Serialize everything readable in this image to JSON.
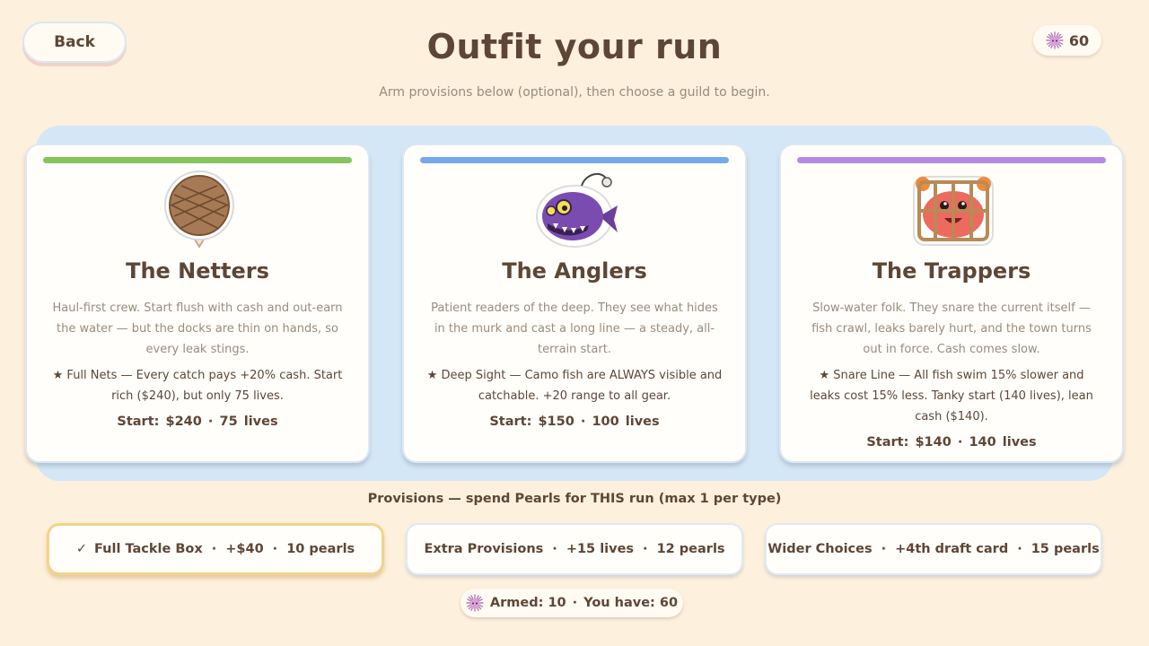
{
  "header": {
    "back_label": "Back",
    "title": "Outfit your run",
    "subtitle": "Arm provisions below (optional), then choose a guild to begin.",
    "pearls": "60"
  },
  "guilds": [
    {
      "name": "The Netters",
      "accent": "#86c45e",
      "icon": "net-ball-icon",
      "description": "Haul-first crew. Start flush with cash and out-earn the water — but the docks are thin on hands, so every leak stings.",
      "perk": "★ Full Nets — Every catch pays +20% cash. Start rich ($240), but only 75 lives.",
      "start_label": "Start:",
      "start_cash": "$240",
      "start_lives": "75 lives"
    },
    {
      "name": "The Anglers",
      "accent": "#76a9ea",
      "icon": "anglerfish-icon",
      "description": "Patient readers of the deep. They see what hides in the murk and cast a long line — a steady, all-terrain start.",
      "perk": "★ Deep Sight — Camo fish are ALWAYS visible and catchable. +20 range to all gear.",
      "start_label": "Start:",
      "start_cash": "$150",
      "start_lives": "100 lives"
    },
    {
      "name": "The Trappers",
      "accent": "#b48be4",
      "icon": "crab-trap-icon",
      "description": "Slow-water folk. They snare the current itself — fish crawl, leaks barely hurt, and the town turns out in force. Cash comes slow.",
      "perk": "★ Snare Line — All fish swim 15% slower and leaks cost 15% less. Tanky start (140 lives), lean cash ($140).",
      "start_label": "Start:",
      "start_cash": "$140",
      "start_lives": "140 lives"
    }
  ],
  "provisions": {
    "heading": "Provisions — spend Pearls for THIS run (max 1 per type)",
    "items": [
      {
        "check": "✓",
        "name": "Full Tackle Box",
        "effect": "+$40",
        "cost": "10 pearls",
        "selected": true
      },
      {
        "check": "",
        "name": "Extra Provisions",
        "effect": "+15 lives",
        "cost": "12 pearls",
        "selected": false
      },
      {
        "check": "",
        "name": "Wider Choices",
        "effect": "+4th draft card",
        "cost": "15 pearls",
        "selected": false
      }
    ]
  },
  "footer": {
    "armed": "Armed: 10",
    "have": "You have: 60"
  },
  "separator": "·"
}
